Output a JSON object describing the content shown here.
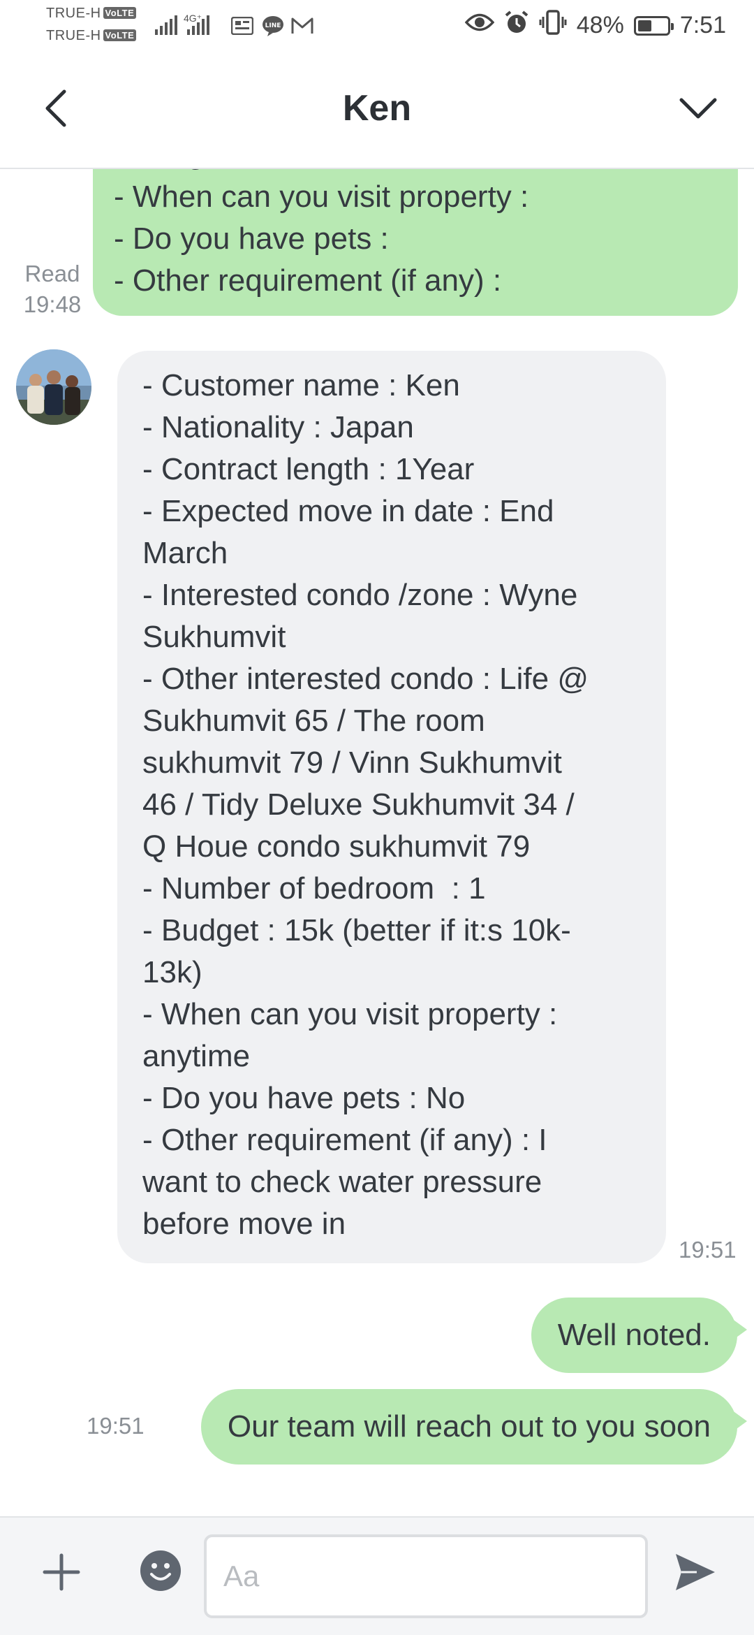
{
  "status_bar": {
    "carrier_1": "TRUE-H",
    "carrier_2": "TRUE-H",
    "volte_badge": "VoLTE",
    "network_type": "4G⁺",
    "battery_text": "48%",
    "battery_level": 0.48,
    "time": "7:51",
    "icons": [
      "signal-icon",
      "signal-4g-icon",
      "notification-app-icon",
      "line-app-icon",
      "gmail-icon",
      "eye-icon",
      "alarm-icon",
      "vibrate-icon",
      "battery-icon"
    ]
  },
  "header": {
    "title": "Ken",
    "back_icon": "chevron-left-icon",
    "menu_icon": "chevron-down-icon"
  },
  "messages": {
    "outgoing_form_tail": {
      "lines": [
        "- When can you visit property :",
        "- Do you have pets :",
        "- Other requirement (if any) :"
      ],
      "status": "Read",
      "time": "19:48"
    },
    "incoming_reply": {
      "sender": "Ken",
      "lines": [
        "- Customer name : Ken",
        "- Nationality : Japan",
        "- Contract length : 1Year",
        "- Expected move in date : End",
        "March",
        "- Interested condo /zone : Wyne",
        "Sukhumvit",
        "- Other interested condo : Life @",
        "Sukhumvit 65 / The room",
        "sukhumvit 79 / Vinn Sukhumvit",
        "46 / Tidy Deluxe Sukhumvit 34 /",
        "Q Houe condo sukhumvit 79",
        "- Number of bedroom  : 1",
        "- Budget : 15k (better if it:s 10k-",
        "13k)",
        "- When can you visit property :",
        "anytime",
        "- Do you have pets : No",
        "- Other requirement (if any) : I",
        "want to check water pressure",
        "before move in"
      ],
      "time": "19:51"
    },
    "outgoing_1": {
      "text": "Well noted."
    },
    "outgoing_2": {
      "text": "Our team will reach out to you soon",
      "time": "19:51"
    }
  },
  "input_bar": {
    "placeholder": "Aa",
    "value": "",
    "icons": [
      "plus-icon",
      "emoji-icon",
      "send-icon"
    ]
  },
  "colors": {
    "outgoing_bubble": "#b8e9b3",
    "incoming_bubble": "#f0f1f3",
    "icon_gray": "#5f6670",
    "timestamp": "#8a8f95"
  }
}
